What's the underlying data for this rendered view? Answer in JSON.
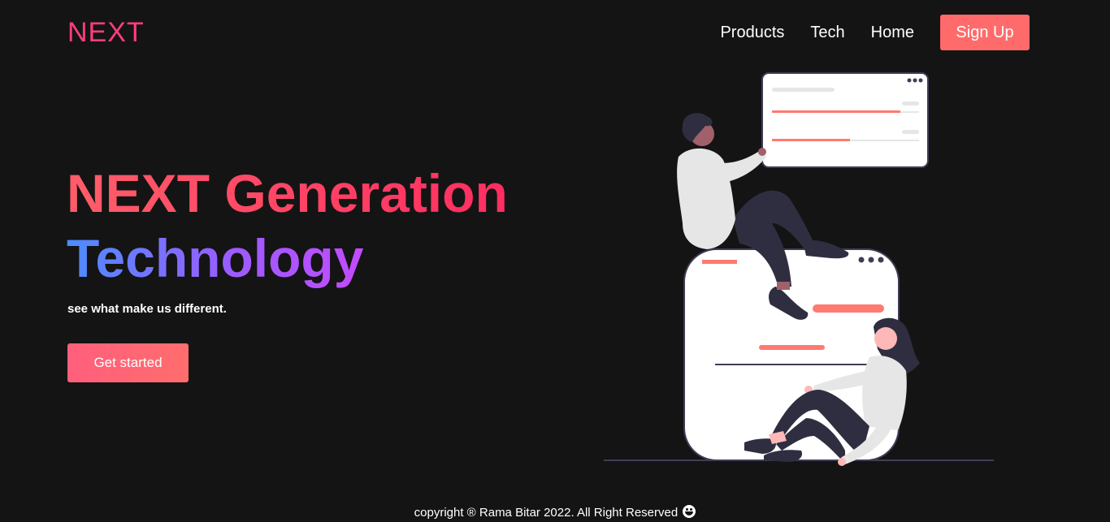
{
  "brand": {
    "logo_text": "NEXT",
    "logo_color": "#ff3d7f"
  },
  "nav": {
    "links": [
      "Products",
      "Tech",
      "Home"
    ],
    "signup_label": "Sign Up",
    "signup_color": "#ff6b6b"
  },
  "hero": {
    "title_line1": "NEXT Generation",
    "title_line2": "Technology",
    "tagline": "see what make us different.",
    "cta_label": "Get started",
    "title_line1_gradient": [
      "#ff5d6a",
      "#ff2d61"
    ],
    "title_line2_gradient": [
      "#4c8dff",
      "#9b5cff",
      "#c34bff"
    ]
  },
  "illustration": {
    "name": "two-people-with-ui-cards-illustration",
    "accent": "#ff7a70"
  },
  "footer": {
    "text": "copyright ® Rama Bitar 2022. All Right Reserved",
    "icon": "smiley-icon"
  }
}
